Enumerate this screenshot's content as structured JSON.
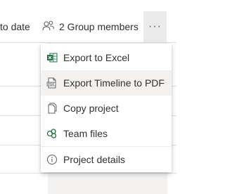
{
  "toolbar": {
    "truncated_label": "to date",
    "group_members_label": "2 Group members",
    "more_label": "···"
  },
  "menu": {
    "items": [
      {
        "label": "Export to Excel",
        "icon": "excel-icon"
      },
      {
        "label": "Export Timeline to PDF",
        "icon": "pdf-icon"
      },
      {
        "label": "Copy project",
        "icon": "copy-icon"
      },
      {
        "label": "Team files",
        "icon": "team-files-icon"
      },
      {
        "label": "Project details",
        "icon": "info-icon"
      }
    ]
  },
  "colors": {
    "excel_green": "#217346",
    "hover_background": "#f3f2f1",
    "more_button_background": "#ebebeb"
  }
}
